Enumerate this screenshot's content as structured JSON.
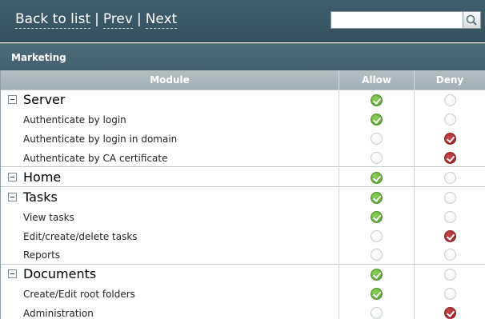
{
  "nav": {
    "back_label": "Back to list",
    "prev_label": "Prev",
    "next_label": "Next",
    "separator": "|"
  },
  "search": {
    "value": "",
    "placeholder": ""
  },
  "group_title": "Marketing",
  "columns": {
    "module": "Module",
    "allow": "Allow",
    "deny": "Deny"
  },
  "rows": [
    {
      "label": "Server",
      "group": true,
      "allow": true,
      "deny": false
    },
    {
      "label": "Authenticate by login",
      "group": false,
      "allow": true,
      "deny": false
    },
    {
      "label": "Authenticate by login in domain",
      "group": false,
      "allow": false,
      "deny": true
    },
    {
      "label": "Authenticate by CA certificate",
      "group": false,
      "allow": false,
      "deny": true
    },
    {
      "label": "Home",
      "group": true,
      "allow": true,
      "deny": false
    },
    {
      "label": "Tasks",
      "group": true,
      "allow": true,
      "deny": false
    },
    {
      "label": "View tasks",
      "group": false,
      "allow": true,
      "deny": false
    },
    {
      "label": "Edit/create/delete tasks",
      "group": false,
      "allow": false,
      "deny": true
    },
    {
      "label": "Reports",
      "group": false,
      "allow": false,
      "deny": false
    },
    {
      "label": "Documents",
      "group": true,
      "allow": true,
      "deny": false
    },
    {
      "label": "Create/Edit root folders",
      "group": false,
      "allow": true,
      "deny": false
    },
    {
      "label": "Administration",
      "group": false,
      "allow": false,
      "deny": true
    }
  ],
  "colors": {
    "header_bg": "#3f5e6d",
    "allow_on": "#4f9b2b",
    "deny_on": "#8e2227"
  },
  "icons": {
    "search": "magnifier-icon",
    "collapse": "minus-box-icon"
  }
}
